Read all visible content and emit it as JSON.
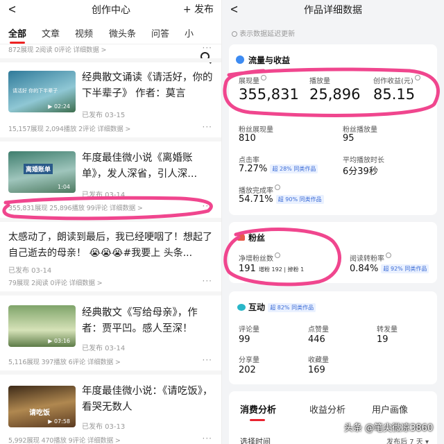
{
  "left": {
    "title": "创作中心",
    "publish": "+ 发布",
    "tabs": [
      "全部",
      "文章",
      "视频",
      "微头条",
      "问答",
      "小"
    ],
    "top_stats": "872展现  2阅读  0评论  详细数据 >",
    "items": [
      {
        "title": "经典散文诵读《请活好，你的下半辈子》 作者：莫言",
        "pub": "已发布  03-15",
        "stats": "15,157展现  2,094播放  2评论  详细数据 >",
        "duration": "▶ 02:24",
        "thumb_text": "请活好  你的下半辈子",
        "thumb_colors": [
          "#2f7a9a",
          "#6fb0c0"
        ]
      },
      {
        "title": "年度最佳微小说《离婚账单》，发人深省，引人深...",
        "pub": "已发布  03-14",
        "stats": "355,831展现  25,896播放  99评论  详细数据 >",
        "duration": "1:04",
        "thumb_text": "离婚账单",
        "thumb_colors": [
          "#3f7e6e",
          "#aac9c0"
        ]
      },
      {
        "title": "太感动了，朗读到最后，我已经哽咽了！想起了自己逝去的母亲！ 😭😭😭#我要上 头条...",
        "pub": "已发布  03-14",
        "stats": "79展现  2阅读  0评论  详细数据 >"
      },
      {
        "title": "经典散文《写给母亲》，作者：贾平凹。感人至深！",
        "pub": "已发布  03-14",
        "stats": "5,116展现  397播放  6评论  详细数据 >",
        "duration": "▶ 03:16",
        "thumb_colors": [
          "#6a8a4a",
          "#c7d6a8"
        ]
      },
      {
        "title": "年度最佳微小说：《请吃饭》，看哭无数人",
        "pub": "已发布  03-13",
        "stats": "5,992展现  470播放  9评论  详细数据 >",
        "duration": "▶ 07:58",
        "thumb_text": "请吃饭",
        "thumb_colors": [
          "#5a3a20",
          "#b58a50"
        ]
      }
    ],
    "more_icon": "···"
  },
  "right": {
    "title": "作品详细数据",
    "delay_note": "表示数据延迟更新",
    "flow": {
      "title": "流量与收益",
      "metrics": [
        {
          "label": "展现量",
          "value": "355,831"
        },
        {
          "label": "播放量",
          "value": "25,896"
        },
        {
          "label": "创作收益(元)",
          "value": "85.15"
        }
      ],
      "fans_show": {
        "label": "粉丝展现量",
        "value": "810"
      },
      "fans_play": {
        "label": "粉丝播放量",
        "value": "95"
      },
      "ctr": {
        "label": "点击率",
        "value": "7.27%",
        "badge": "超 28% 同类作品"
      },
      "avg_time": {
        "label": "平均播放时长",
        "value": "6分39秒"
      },
      "complete": {
        "label": "播放完成率",
        "value": "54.71%",
        "badge": "超 90% 同类作品"
      }
    },
    "fans": {
      "title": "粉丝",
      "net": {
        "label": "净增粉丝数",
        "value": "191",
        "detail": "增粉 192 | 掉粉 1"
      },
      "conv": {
        "label": "阅读转粉率",
        "value": "0.84%",
        "badge": "超 92% 同类作品"
      }
    },
    "interact": {
      "title": "互动",
      "badge": "超 82% 同类作品",
      "items": [
        {
          "label": "评论量",
          "value": "99"
        },
        {
          "label": "点赞量",
          "value": "446"
        },
        {
          "label": "转发量",
          "value": "19"
        },
        {
          "label": "分享量",
          "value": "202"
        },
        {
          "label": "收藏量",
          "value": "169"
        }
      ]
    },
    "bottom_tabs": [
      "消费分析",
      "收益分析",
      "用户画像"
    ],
    "time_label": "选择时间",
    "time_value": "发布后 7 天 ▾",
    "watermark": "头条 @笔尖微凉3860"
  },
  "colors": {
    "accent": "#e8232f",
    "highlight": "#f0468e",
    "badge": "#3a6bd6"
  }
}
